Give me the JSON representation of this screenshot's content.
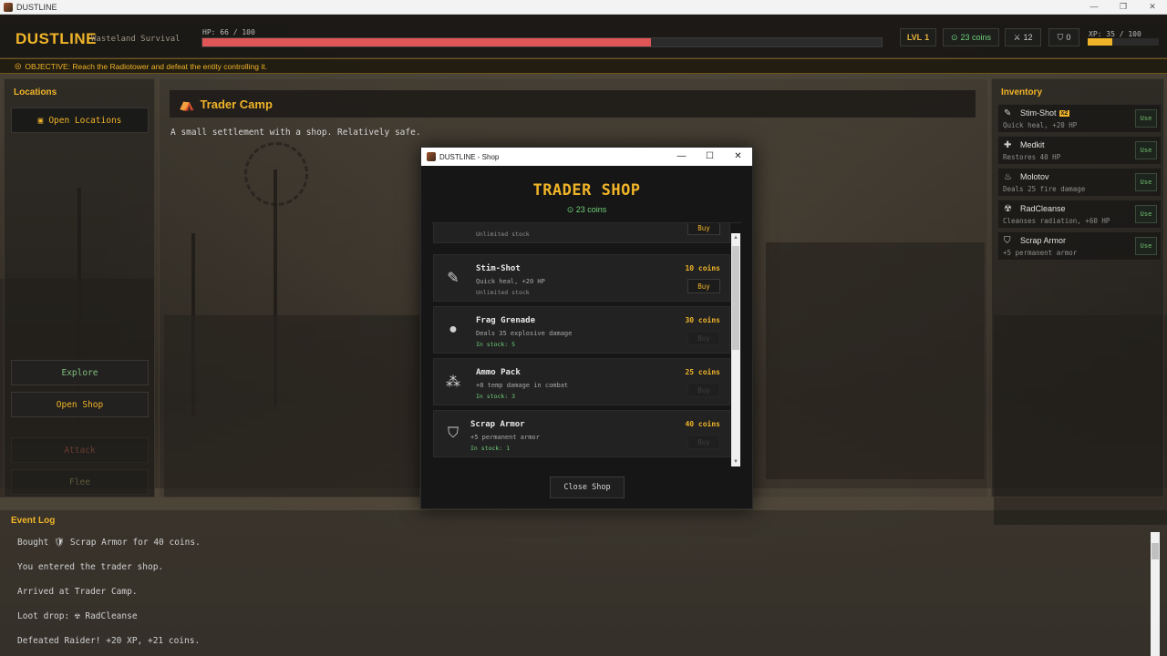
{
  "os_window": {
    "title": "DUSTLINE"
  },
  "hud": {
    "brand": "DUSTLINE",
    "subtitle": "Wasteland Survival",
    "hp_label": "HP: 66 / 100",
    "hp_fraction": 0.66,
    "level_prefix": "LVL",
    "level": "1",
    "coins": "23 coins",
    "kills": "12",
    "armor": "0",
    "xp_label": "XP: 35 / 100",
    "xp_fraction": 0.35
  },
  "objective": {
    "text": "OBJECTIVE: Reach the Radiotower and defeat the entity controlling it."
  },
  "left_panel": {
    "title": "Locations",
    "open_locations": "Open Locations",
    "explore": "Explore",
    "open_shop": "Open Shop",
    "attack": "Attack",
    "flee": "Flee"
  },
  "location": {
    "name": "Trader Camp",
    "description": "A small settlement with a shop. Relatively safe."
  },
  "inventory": {
    "title": "Inventory",
    "use_label": "Use",
    "items": [
      {
        "name": "Stim-Shot",
        "qty": "x2",
        "desc": "Quick heal, +20 HP",
        "icon": "syringe-icon"
      },
      {
        "name": "Medkit",
        "qty": "",
        "desc": "Restores 40 HP",
        "icon": "medkit-icon"
      },
      {
        "name": "Molotov",
        "qty": "",
        "desc": "Deals 25 fire damage",
        "icon": "fire-icon"
      },
      {
        "name": "RadCleanse",
        "qty": "",
        "desc": "Cleanses radiation, +60 HP",
        "icon": "radiation-icon"
      },
      {
        "name": "Scrap Armor",
        "qty": "",
        "desc": "+5 permanent armor",
        "icon": "shield-icon"
      }
    ]
  },
  "event_log": {
    "title": "Event Log",
    "lines": [
      "Bought 🛡 Scrap Armor for 40 coins.",
      "You entered the trader shop.",
      "Arrived at Trader Camp.",
      "Loot drop: ☢ RadCleanse",
      "Defeated Raider! +20 XP, +21 coins."
    ]
  },
  "shop": {
    "window_title": "DUSTLINE - Shop",
    "heading": "TRADER SHOP",
    "coins": "23 coins",
    "buy_label": "Buy",
    "close_label": "Close Shop",
    "partial_item": {
      "stock": "Unlimited stock"
    },
    "items": [
      {
        "name": "Stim-Shot",
        "desc": "Quick heal, +20 HP",
        "stock": "Unlimited stock",
        "price": "10 coins",
        "affordable": true,
        "icon": "syringe-icon"
      },
      {
        "name": "Frag Grenade",
        "desc": "Deals 35 explosive damage",
        "stock": "In stock: 5",
        "price": "30 coins",
        "affordable": false,
        "icon": "bomb-icon"
      },
      {
        "name": "Ammo Pack",
        "desc": "+8 temp damage in combat",
        "stock": "In stock: 3",
        "price": "25 coins",
        "affordable": false,
        "icon": "ammo-icon"
      },
      {
        "name": "Scrap Armor",
        "desc": "+5 permanent armor",
        "stock": "In stock: 1",
        "price": "40 coins",
        "affordable": false,
        "icon": "shield-icon"
      }
    ]
  },
  "colors": {
    "accent": "#f0b429",
    "hp": "#e05555",
    "coins": "#6fd27a"
  }
}
